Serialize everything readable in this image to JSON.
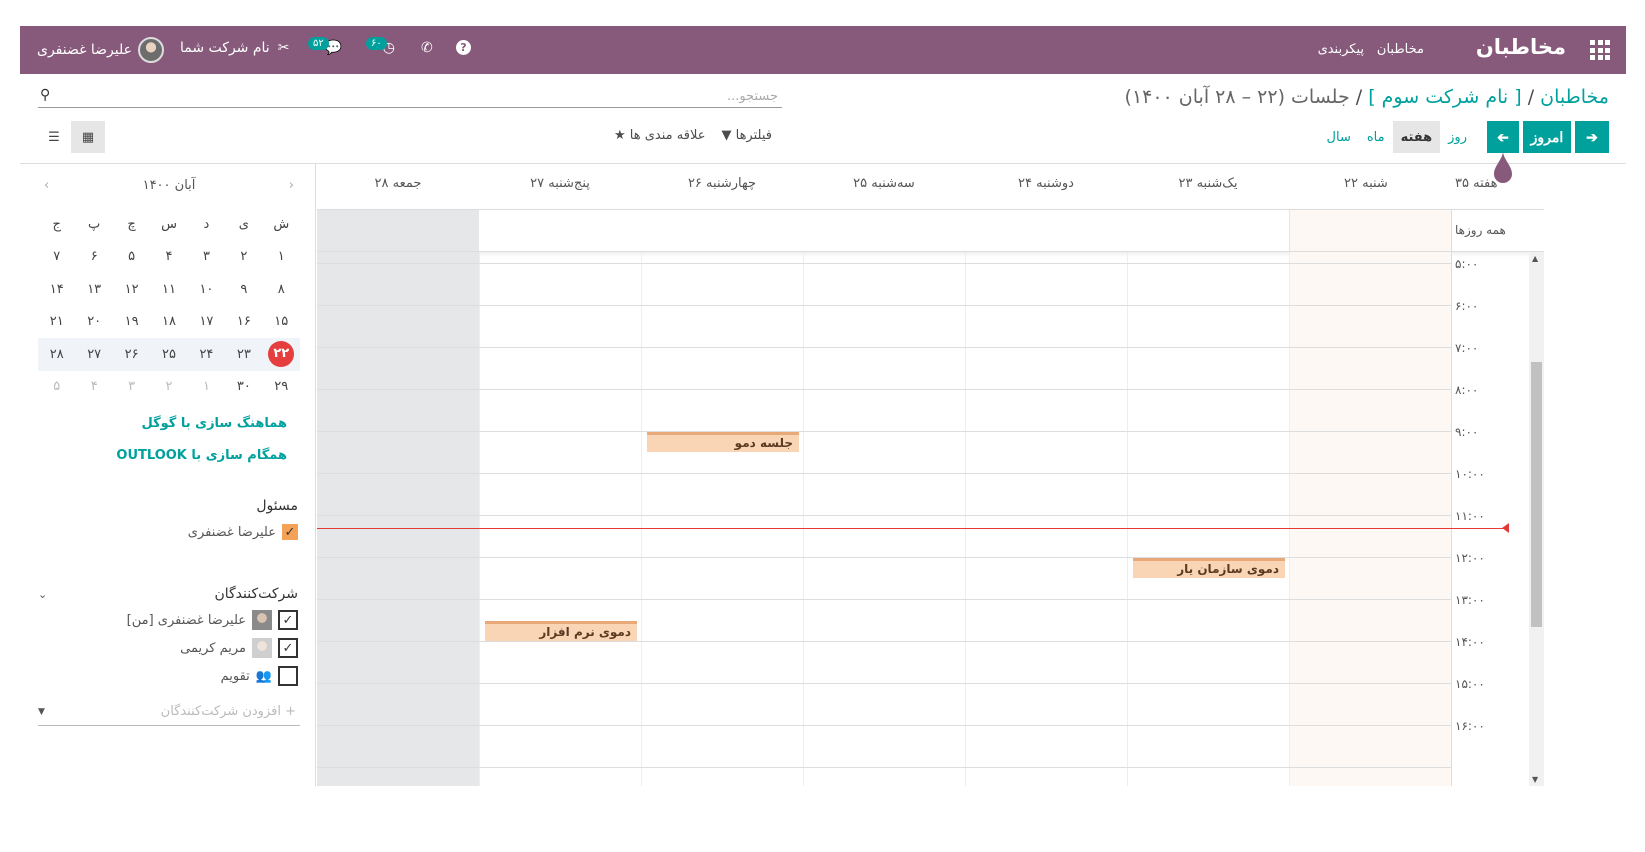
{
  "topbar": {
    "brand": "مخاطبان",
    "menu": [
      "مخاطبان",
      "پیکربندی"
    ],
    "chat_badge": "۵۲",
    "activity_badge": "۶۰",
    "company": "نام شرکت شما",
    "user": "علیرضا غضنفری"
  },
  "breadcrumb": {
    "root": "مخاطبان",
    "company": "[ نام شرکت سوم ]",
    "current": "جلسات (۲۲ – ۲۸ آبان ۱۴۰۰)"
  },
  "search": {
    "placeholder": "جستجو..."
  },
  "nav": {
    "today": "امروز",
    "scales": [
      "روز",
      "هفته",
      "ماه",
      "سال"
    ],
    "filters": "فیلترها",
    "favorites": "علاقه مندی ها"
  },
  "calendar": {
    "week_label": "هفته ۳۵",
    "days": [
      "شنبه ۲۲",
      "یک‌شنبه ۲۳",
      "دوشنبه ۲۴",
      "سه‌شنبه ۲۵",
      "چهارشنبه ۲۶",
      "پنج‌شنبه ۲۷",
      "جمعه ۲۸"
    ],
    "all_day": "همه روزها",
    "hours": [
      "۵:۰۰",
      "۶:۰۰",
      "۷:۰۰",
      "۸:۰۰",
      "۹:۰۰",
      "۱۰:۰۰",
      "۱۱:۰۰",
      "۱۲:۰۰",
      "۱۳:۰۰",
      "۱۴:۰۰",
      "۱۵:۰۰",
      "۱۶:۰۰"
    ],
    "events": [
      {
        "title": "جلسه دمو",
        "day": 4,
        "start": 9.0
      },
      {
        "title": "دموی سازمان یار",
        "day": 1,
        "start": 12.0
      },
      {
        "title": "دموی نرم افزار",
        "day": 5,
        "start": 13.5
      }
    ]
  },
  "minical": {
    "title": "آبان ۱۴۰۰",
    "weekdays": [
      "ش",
      "ی",
      "د",
      "س",
      "چ",
      "پ",
      "ج"
    ],
    "weeks": [
      [
        "۱",
        "۲",
        "۳",
        "۴",
        "۵",
        "۶",
        "۷"
      ],
      [
        "۸",
        "۹",
        "۱۰",
        "۱۱",
        "۱۲",
        "۱۳",
        "۱۴"
      ],
      [
        "۱۵",
        "۱۶",
        "۱۷",
        "۱۸",
        "۱۹",
        "۲۰",
        "۲۱"
      ],
      [
        "۲۲",
        "۲۳",
        "۲۴",
        "۲۵",
        "۲۶",
        "۲۷",
        "۲۸"
      ],
      [
        "۲۹",
        "۳۰",
        "۱",
        "۲",
        "۳",
        "۴",
        "۵"
      ]
    ]
  },
  "sync": {
    "google": "هماهنگ سازی با گوگل",
    "outlook": "همگام سازی با OUTLOOK"
  },
  "responsible": {
    "title": "مسئول",
    "items": [
      "علیرضا غضنفری"
    ]
  },
  "attendees": {
    "title": "شرکت‌کنندگان",
    "items": [
      "علیرضا غضنفری [من]",
      "مریم کریمی",
      "تقویم"
    ],
    "add": "+ افزودن شرکت‌کنندگان"
  }
}
